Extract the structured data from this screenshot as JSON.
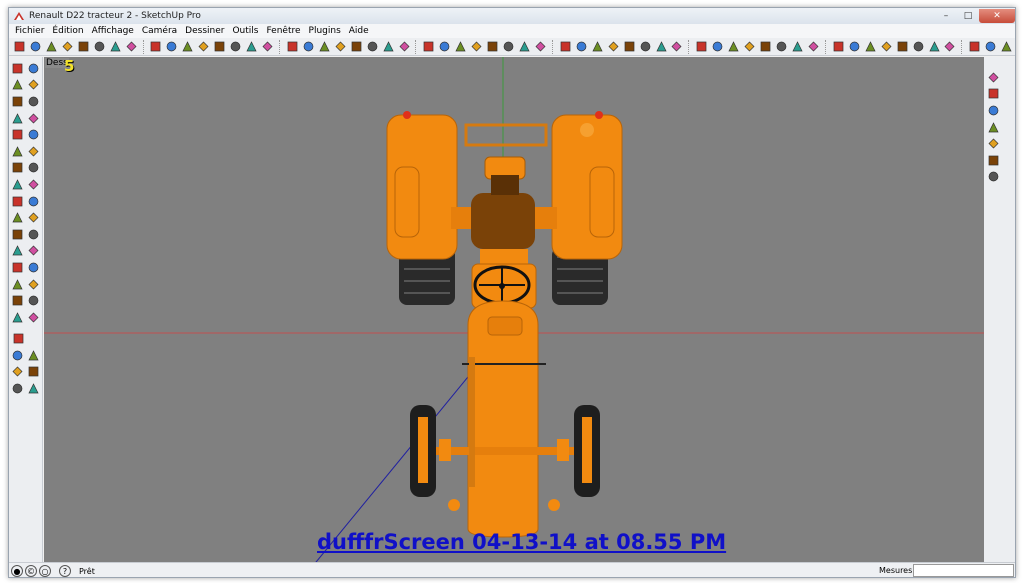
{
  "window": {
    "title": "Renault D22 tracteur 2 - SketchUp Pro",
    "minimize": "–",
    "maximize": "□",
    "close": "✕"
  },
  "menu": [
    "Fichier",
    "Édition",
    "Affichage",
    "Caméra",
    "Dessiner",
    "Outils",
    "Fenêtre",
    "Plugins",
    "Aide"
  ],
  "viewport": {
    "scene_label": "Dess",
    "scene_number": "5",
    "watermark": "dufffrScreen 04-13-14 at 08.55 PM",
    "background": "#808080",
    "model_color": "#f28a10",
    "seat_color": "#7a4208"
  },
  "toolbar_icons": [
    "select-arrow",
    "eraser",
    "pencil",
    "rectangle",
    "circle",
    "arc",
    "shape",
    "push-pull",
    "follow-me",
    "move",
    "rotate",
    "scale",
    "offset",
    "tape",
    "dimension",
    "protractor",
    "text",
    "axes",
    "3d-text",
    "paint",
    "zoom",
    "zoom-window",
    "zoom-extents",
    "orbit",
    "pan",
    "walk",
    "look-around",
    "position-camera",
    "section-plane",
    "iso",
    "top",
    "front",
    "right",
    "back",
    "left",
    "xray",
    "wireframe",
    "hidden-line",
    "shaded",
    "textured",
    "monochrome",
    "sandbox-1",
    "sandbox-2",
    "sandbox-3",
    "sandbox-4",
    "sandbox-5",
    "sandbox-6",
    "sandbox-7",
    "geo",
    "photo-texture",
    "match-photo",
    "shadow",
    "fog",
    "styles",
    "layers",
    "components",
    "materials",
    "scenes",
    "outliner"
  ],
  "left_tools": [
    [
      "select-icon",
      "component-icon"
    ],
    [
      "paint-icon",
      "eraser-icon"
    ],
    [
      "rectangle-icon",
      "line-icon"
    ],
    [
      "circle-icon",
      "arc-icon"
    ],
    [
      "polygon-icon",
      "freehand-icon"
    ],
    [
      "move-icon",
      "pushpull-icon"
    ],
    [
      "rotate-icon",
      "followme-icon"
    ],
    [
      "scale-icon",
      "offset-icon"
    ],
    [
      "tape-icon",
      "dimension-icon"
    ],
    [
      "protractor-icon",
      "text-icon"
    ],
    [
      "axes-icon",
      "3dtext-icon"
    ],
    [
      "orbit-icon",
      "pan-icon"
    ],
    [
      "zoom-icon",
      "zoom-window-icon"
    ],
    [
      "zoom-extents-icon",
      "previous-icon"
    ],
    [
      "position-camera-icon",
      "look-around-icon"
    ],
    [
      "walk-icon",
      "section-icon"
    ]
  ],
  "left_tools_2": [
    [
      "sandbox-icon"
    ],
    [
      "smoove-icon",
      "stamp-icon"
    ],
    [
      "drape-icon",
      "add-detail-icon"
    ],
    [
      "flip-edge-icon",
      "hand-icon"
    ]
  ],
  "right_tools": [
    [
      "curve-icon"
    ],
    [
      "house-icon"
    ],
    [
      "red-tool-icon"
    ],
    [
      "box-icon"
    ],
    [
      "stairs-icon"
    ],
    [
      "stack-icon"
    ],
    [
      "stack2-icon"
    ]
  ],
  "status": {
    "text": "Prêt",
    "measures_label": "Mesures"
  }
}
